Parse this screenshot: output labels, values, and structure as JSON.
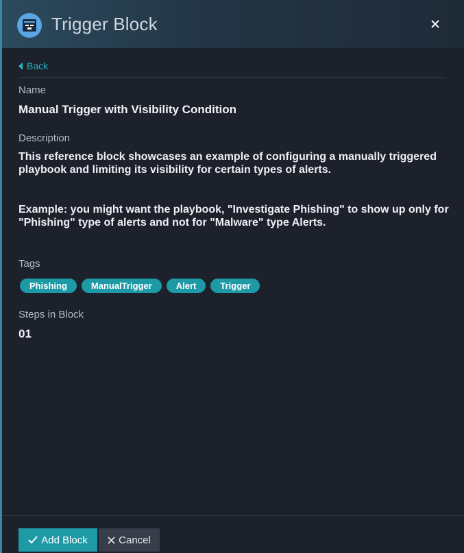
{
  "header": {
    "title": "Trigger Block",
    "icon": "trigger-block-icon",
    "close_icon": "close-icon",
    "accent": "#5aa6e4"
  },
  "nav": {
    "back_label": "Back"
  },
  "fields": {
    "name_label": "Name",
    "name_value": "Manual Trigger with Visibility Condition",
    "description_label": "Description",
    "description_p1": "This reference block showcases an example of configuring a manually triggered playbook and limiting its visibility for certain types of alerts.",
    "description_p2": "Example: you might want the playbook, \"Investigate Phishing\" to show up only for \"Phishing\" type of alerts and not for \"Malware\" type Alerts.",
    "tags_label": "Tags",
    "tags": [
      "Phishing",
      "ManualTrigger",
      "Alert",
      "Trigger"
    ],
    "steps_label": "Steps in Block",
    "steps_value": "01"
  },
  "footer": {
    "add_label": "Add Block",
    "cancel_label": "Cancel",
    "add_color": "#1e9aa6"
  }
}
